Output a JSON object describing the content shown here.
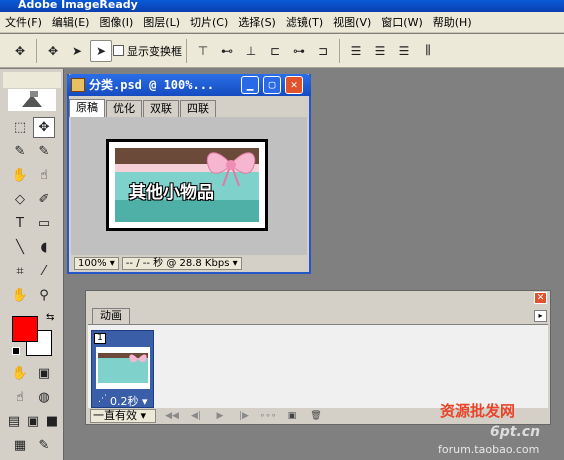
{
  "app": {
    "title": "Adobe ImageReady"
  },
  "menu": {
    "items": [
      "文件(F)",
      "编辑(E)",
      "图像(I)",
      "图层(L)",
      "切片(C)",
      "选择(S)",
      "滤镜(T)",
      "视图(V)",
      "窗口(W)",
      "帮助(H)"
    ]
  },
  "options": {
    "show_transform_label": "显示变换框"
  },
  "document": {
    "title": "分类.psd @ 100%...",
    "tabs": [
      "原稿",
      "优化",
      "双联",
      "四联"
    ],
    "active_tab": "原稿",
    "art_text": "其他小物品",
    "zoom": "100%",
    "status": "-- / -- 秒 @ 28.8 Kbps"
  },
  "animation": {
    "tab_label": "动画",
    "frame_number": "1",
    "frame_delay": "0.2秒",
    "loop": "一直有效"
  },
  "watermark": {
    "line1": "资源批发网",
    "line2": "6pt.cn",
    "line3": "forum.taobao.com"
  },
  "colors": {
    "foreground": "#ff0000",
    "background": "#ffffff",
    "title_bar": "#1a57d6"
  }
}
